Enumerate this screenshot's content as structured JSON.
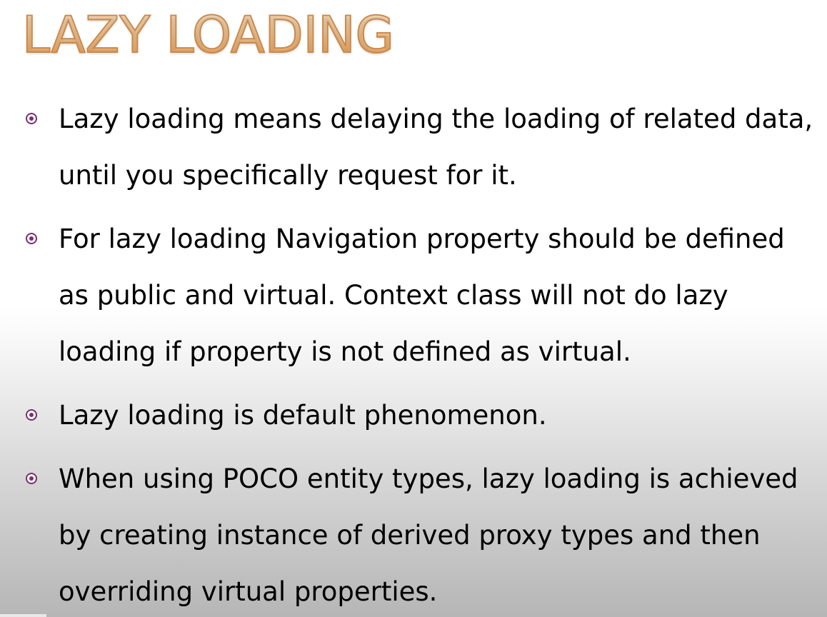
{
  "slide": {
    "title": "LAZY LOADING",
    "bullets": [
      {
        "text": "Lazy loading means delaying the loading of related data, until you specifically request for it."
      },
      {
        "text": "For lazy loading Navigation property should be defined as public and virtual. Context class will not do lazy loading if property is not defined as virtual."
      },
      {
        "text": "Lazy loading is default phenomenon."
      },
      {
        "text": "When using POCO entity types, lazy loading is achieved by creating instance of derived proxy types and then overriding virtual properties."
      }
    ]
  },
  "colors": {
    "title_fill": "#fbd3a2",
    "title_outline": "#c98a4f",
    "bullet_accent": "#7b2e6e",
    "body_text": "#000000"
  }
}
